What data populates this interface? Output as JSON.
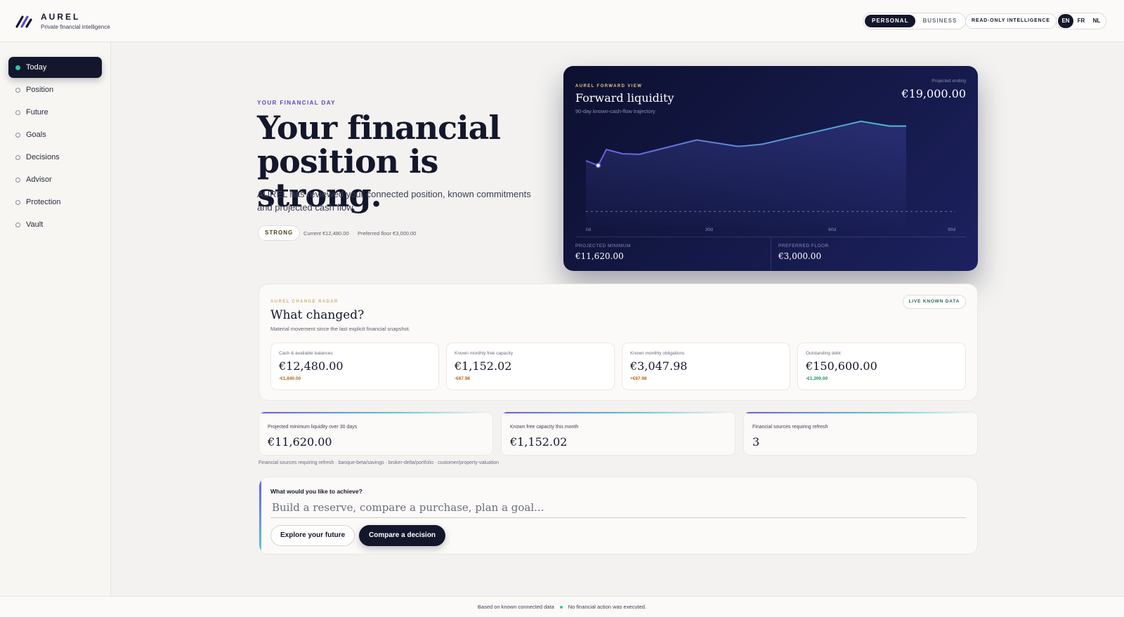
{
  "brand": {
    "name": "AUREL",
    "tagline": "Private financial intelligence"
  },
  "header": {
    "modes": [
      "PERSONAL",
      "BUSINESS"
    ],
    "active_mode": "PERSONAL",
    "read_only": "READ-ONLY INTELLIGENCE",
    "languages": [
      "EN",
      "FR",
      "NL"
    ],
    "active_language": "EN"
  },
  "sidebar": {
    "items": [
      {
        "label": "Today",
        "active": true
      },
      {
        "label": "Position",
        "active": false
      },
      {
        "label": "Future",
        "active": false
      },
      {
        "label": "Goals",
        "active": false
      },
      {
        "label": "Decisions",
        "active": false
      },
      {
        "label": "Advisor",
        "active": false
      },
      {
        "label": "Protection",
        "active": false
      },
      {
        "label": "Vault",
        "active": false
      }
    ]
  },
  "hero": {
    "eyebrow": "YOUR FINANCIAL DAY",
    "title": "Your financial position is strong.",
    "text": "AUREL has reviewed your connected position, known commitments and projected cash flow.",
    "status_badge": "STRONG",
    "current": "Current €12,480.00",
    "preferred_floor": "Preferred floor €3,000.00"
  },
  "forward": {
    "eyebrow": "AUREL FORWARD VIEW",
    "title": "Forward liquidity",
    "subtitle": "90-day known-cash-flow trajectory",
    "projected_ending_label": "Projected ending",
    "projected_ending_value": "€19,000.00",
    "projected_minimum_label": "PROJECTED MINIMUM",
    "projected_minimum_value": "€11,620.00",
    "preferred_floor_label": "PREFERRED FLOOR",
    "preferred_floor_value": "€3,000.00"
  },
  "chart_data": {
    "type": "area",
    "title": "Forward liquidity",
    "x_ticks": [
      "0d",
      "30d",
      "60d",
      "90d"
    ],
    "x": [
      0,
      3,
      5,
      9,
      13,
      27,
      37,
      39,
      43,
      67,
      74,
      78
    ],
    "values": [
      12500,
      11620,
      14600,
      13800,
      13700,
      16400,
      15200,
      15300,
      15600,
      19900,
      19000,
      19000
    ],
    "floor": 3000,
    "highlight_x": 3,
    "xlim": [
      0,
      90
    ],
    "ylim": [
      0,
      25000
    ],
    "colors": {
      "line_start": "#6b5be0",
      "line_end": "#4fc0cf",
      "floor": "#6d7399"
    }
  },
  "radar": {
    "eyebrow": "AUREL CHANGE RADAR",
    "title": "What changed?",
    "subtitle": "Material movement since the last explicit financial snapshot.",
    "live_badge": "LIVE KNOWN DATA",
    "metrics": [
      {
        "label": "Cash & available balances",
        "value": "€12,480.00",
        "delta": "-€1,840.00",
        "tone": "warn"
      },
      {
        "label": "Known monthly free capacity",
        "value": "€1,152.02",
        "delta": "-€87.98",
        "tone": "warn"
      },
      {
        "label": "Known monthly obligations",
        "value": "€3,047.98",
        "delta": "+€87.98",
        "tone": "warn"
      },
      {
        "label": "Outstanding debt",
        "value": "€150,600.00",
        "delta": "-€1,300.00",
        "tone": "good"
      }
    ]
  },
  "summary": [
    {
      "label": "Projected minimum liquidity over 30 days",
      "value": "€11,620.00"
    },
    {
      "label": "Known free capacity this month",
      "value": "€1,152.02"
    },
    {
      "label": "Financial sources requiring refresh",
      "value": "3"
    }
  ],
  "refresh_line": "Financial sources requiring refresh · banque-beta/savings · broker-delta/portfolio · customer/property-valuation",
  "intent": {
    "question": "What would you like to achieve?",
    "placeholder": "Build a reserve, compare a purchase, plan a goal...",
    "explore_label": "Explore your future",
    "compare_label": "Compare a decision"
  },
  "footer": {
    "left": "Based on known connected data",
    "right": "No financial action was executed."
  },
  "colors": {
    "ink": "#14162b",
    "accent_violet": "#5b45c9",
    "accent_teal": "#2fc6a0",
    "delta_warn": "#b5651d",
    "delta_good": "#1f8a63"
  }
}
